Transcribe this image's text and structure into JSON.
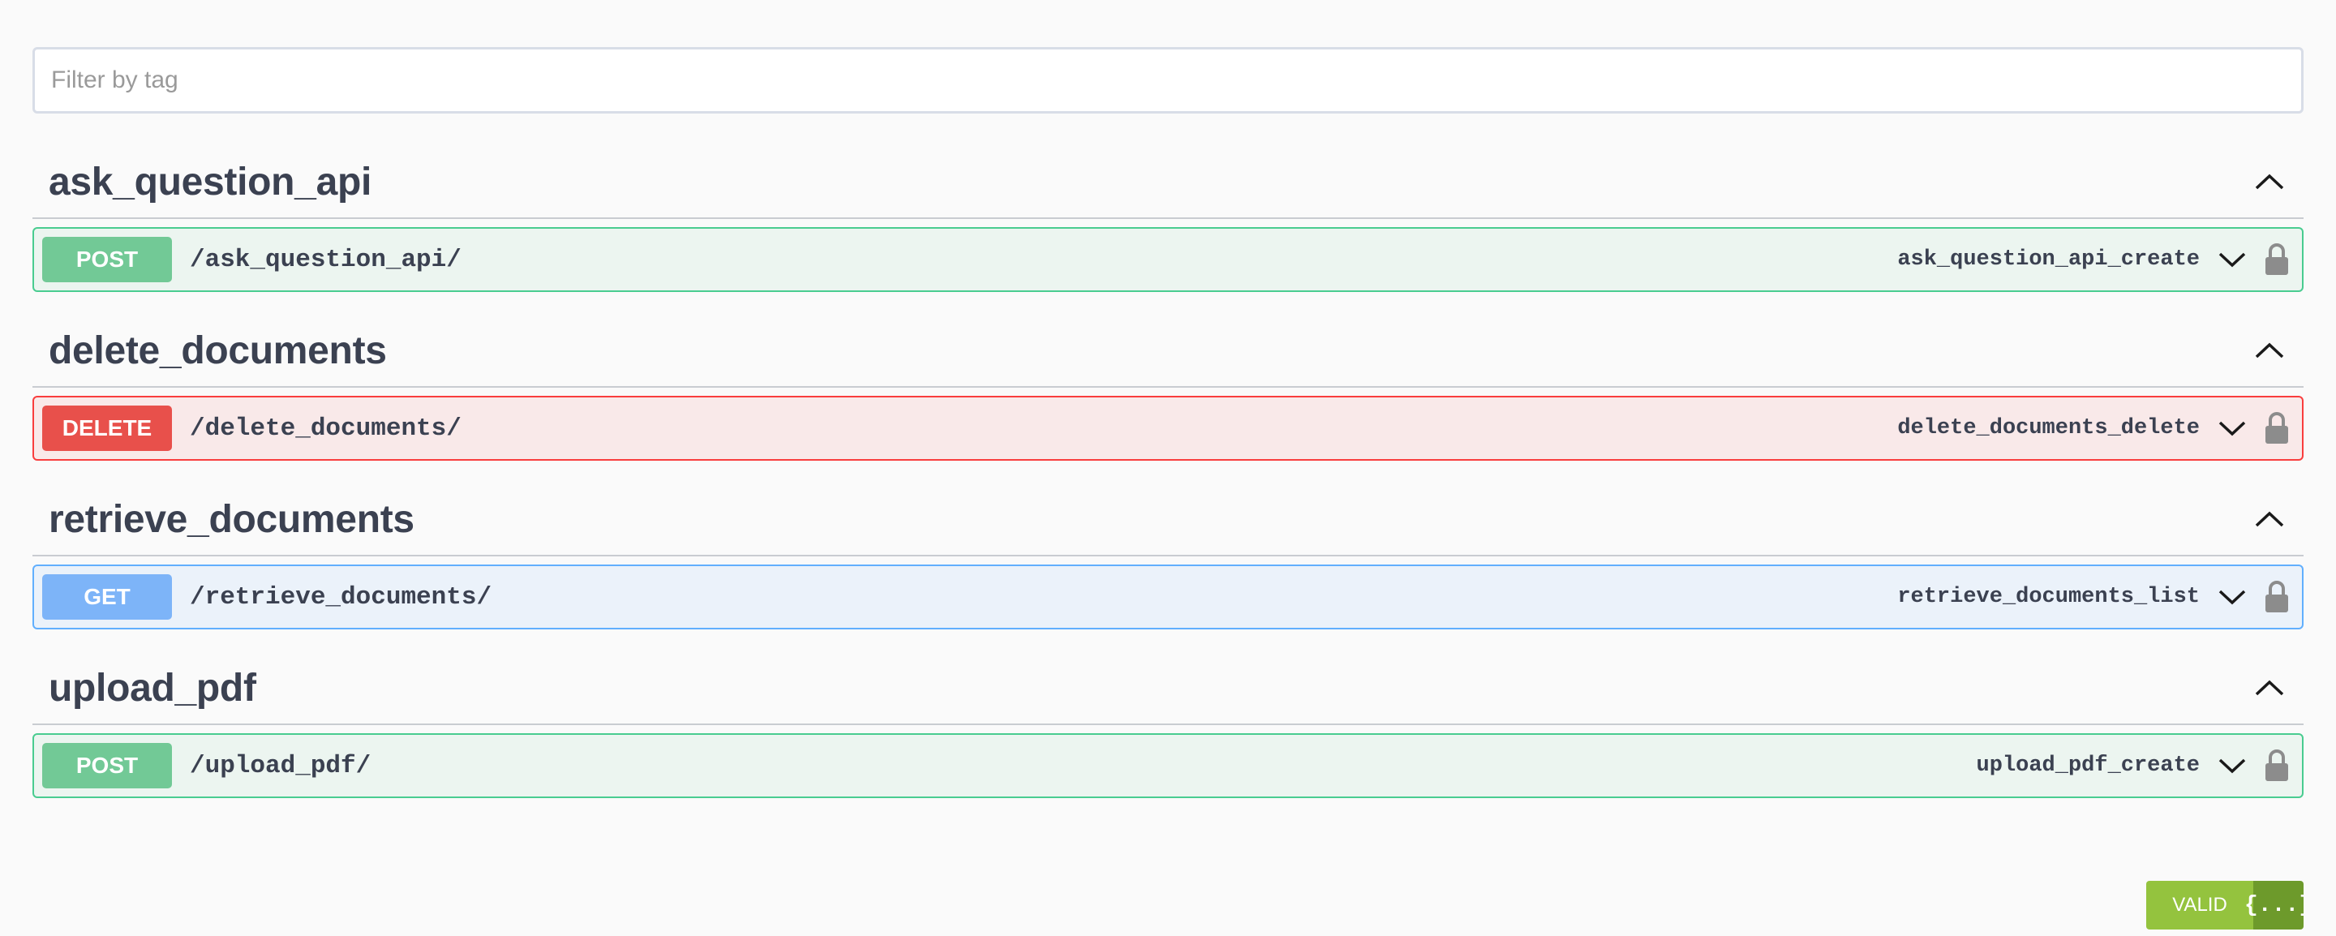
{
  "filter": {
    "placeholder": "Filter by tag",
    "value": ""
  },
  "tags": [
    {
      "name": "ask_question_api",
      "operations": [
        {
          "method": "POST",
          "path": "/ask_question_api/",
          "operation_id": "ask_question_api_create",
          "icon": "lock-icon"
        }
      ]
    },
    {
      "name": "delete_documents",
      "operations": [
        {
          "method": "DELETE",
          "path": "/delete_documents/",
          "operation_id": "delete_documents_delete",
          "icon": "lock-icon"
        }
      ]
    },
    {
      "name": "retrieve_documents",
      "operations": [
        {
          "method": "GET",
          "path": "/retrieve_documents/",
          "operation_id": "retrieve_documents_list",
          "icon": "lock-icon"
        }
      ]
    },
    {
      "name": "upload_pdf",
      "operations": [
        {
          "method": "POST",
          "path": "/upload_pdf/",
          "operation_id": "upload_pdf_create",
          "icon": "lock-icon"
        }
      ]
    }
  ],
  "validator": {
    "label": "VALID",
    "icon_text": "{...}"
  },
  "colors": {
    "post": "#49cc90",
    "delete": "#f93e3e",
    "get": "#61affe",
    "valid": "#94c33e"
  }
}
